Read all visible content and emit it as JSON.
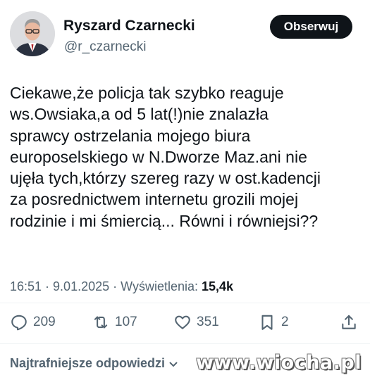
{
  "author": {
    "display_name": "Ryszard Czarnecki",
    "handle": "@r_czarnecki",
    "avatar_icon": "user-photo-avatar"
  },
  "follow_button": {
    "label": "Obserwuj"
  },
  "tweet": {
    "lines": [
      "Ciekawe,że policja tak szybko reaguje",
      "ws.Owsiaka,a od 5 lat(!)nie znalazła",
      "sprawcy ostrzelania mojego biura",
      "europoselskiego w N.Dworze Maz.ani nie",
      "ujęła tych,którzy szereg razy w ost.kadencji",
      "za posrednictwem internetu grozili mojej",
      "rodzinie i mi śmiercią... Równi i równiejsi??"
    ]
  },
  "meta": {
    "time": "16:51",
    "separator": " · ",
    "date": "9.01.2025",
    "views_label": "Wyświetlenia:",
    "views_count": "15,4k"
  },
  "actions": {
    "replies": {
      "icon": "reply-bubble-icon",
      "count": "209"
    },
    "reposts": {
      "icon": "repost-icon",
      "count": "107"
    },
    "likes": {
      "icon": "heart-icon",
      "count": "351"
    },
    "bookmarks": {
      "icon": "bookmark-icon",
      "count": "2"
    },
    "share": {
      "icon": "share-icon"
    }
  },
  "replies_sort": {
    "label": "Najtrafniejsze odpowiedzi",
    "icon": "chevron-down-icon"
  },
  "watermark": {
    "text": "www.wiocha.pl"
  },
  "colors": {
    "text_primary": "#0f1419",
    "text_secondary": "#536471",
    "button_bg": "#0f1419",
    "divider": "#eff3f4"
  }
}
